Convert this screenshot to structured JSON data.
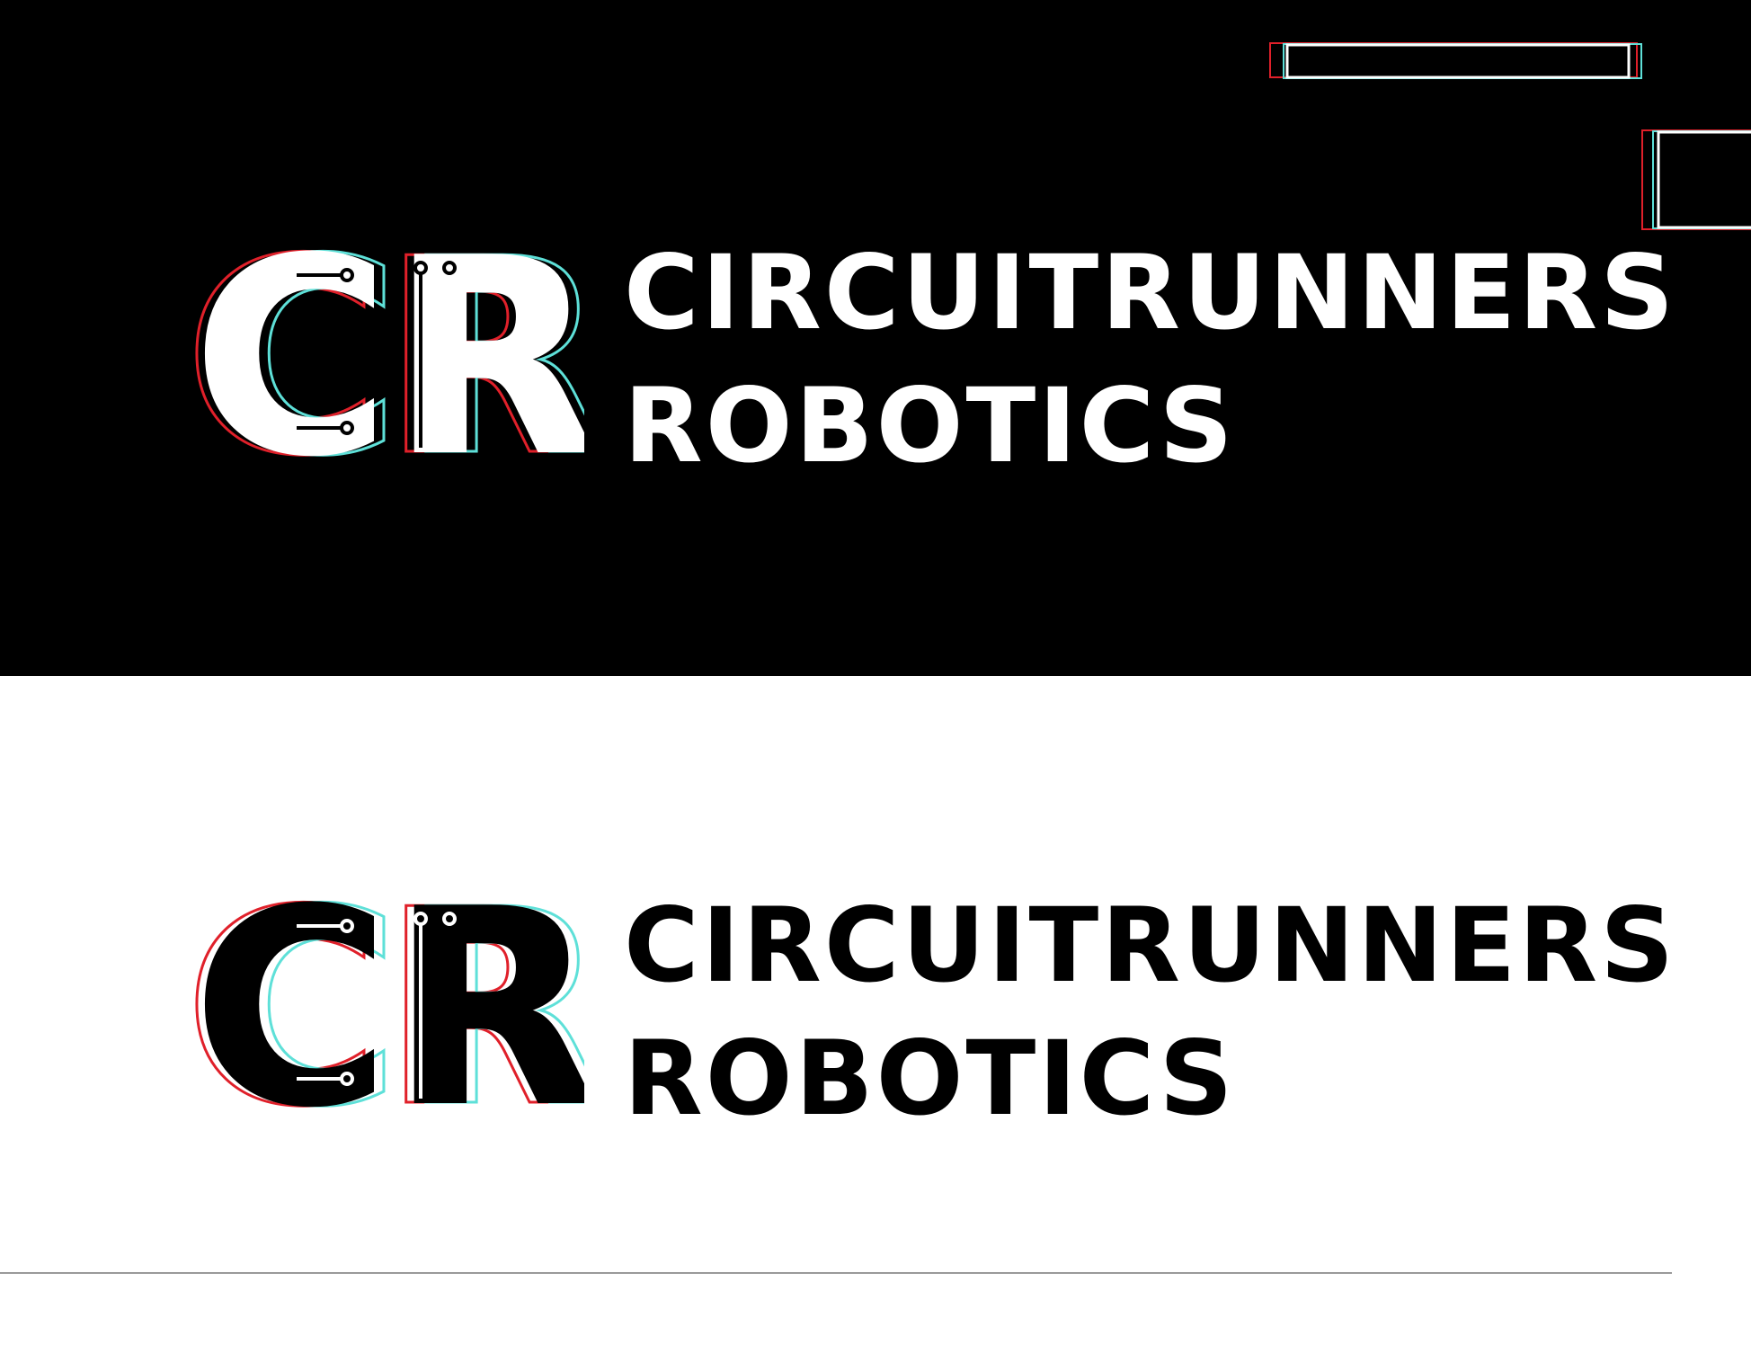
{
  "colors": {
    "dark_background": "#000000",
    "light_background": "#ffffff",
    "glitch_red": "#e0202a",
    "glitch_cyan": "#5ee0d8",
    "divider": "#9a9a9a"
  },
  "logo_dark": {
    "monogram": "CR",
    "line1": "CIRCUITRUNNERS",
    "line2": "ROBOTICS"
  },
  "logo_light": {
    "monogram": "CR",
    "line1": "CIRCUITRUNNERS",
    "line2": "ROBOTICS"
  }
}
